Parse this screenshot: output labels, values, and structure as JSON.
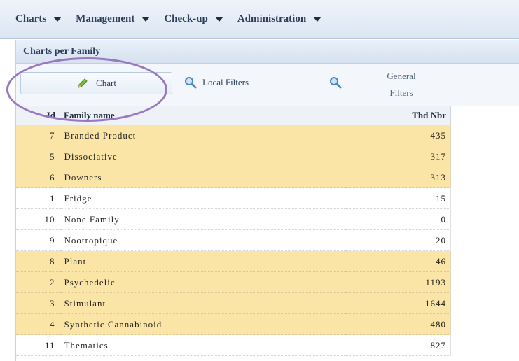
{
  "menu": {
    "items": [
      {
        "label": "Charts"
      },
      {
        "label": "Management"
      },
      {
        "label": "Check-up"
      },
      {
        "label": "Administration"
      }
    ]
  },
  "panel": {
    "title": "Charts per Family"
  },
  "toolbar": {
    "chart_label": "Chart",
    "local_filters_label": "Local Filters",
    "general_filters_line1": "General",
    "general_filters_line2": "Filters"
  },
  "table": {
    "columns": {
      "id": "Id",
      "name": "Family name",
      "nbr": "Thd Nbr"
    },
    "rows": [
      {
        "id": "7",
        "name": "Branded Product",
        "nbr": "435",
        "highlight": true
      },
      {
        "id": "5",
        "name": "Dissociative",
        "nbr": "317",
        "highlight": true
      },
      {
        "id": "6",
        "name": "Downers",
        "nbr": "313",
        "highlight": true
      },
      {
        "id": "1",
        "name": "Fridge",
        "nbr": "15",
        "highlight": false
      },
      {
        "id": "10",
        "name": "None Family",
        "nbr": "0",
        "highlight": false
      },
      {
        "id": "9",
        "name": "Nootropique",
        "nbr": "20",
        "highlight": false
      },
      {
        "id": "8",
        "name": "Plant",
        "nbr": "46",
        "highlight": true
      },
      {
        "id": "2",
        "name": "Psychedelic",
        "nbr": "1193",
        "highlight": true
      },
      {
        "id": "3",
        "name": "Stimulant",
        "nbr": "1644",
        "highlight": true
      },
      {
        "id": "4",
        "name": "Synthetic Cannabinoid",
        "nbr": "480",
        "highlight": true
      },
      {
        "id": "11",
        "name": "Thematics",
        "nbr": "827",
        "highlight": false
      }
    ]
  },
  "colors": {
    "highlight_row": "#fbe5a6",
    "annotation_ellipse": "#9a78c1"
  },
  "icons": {
    "chart": "pencil-icon",
    "local_filters": "search-icon",
    "general_filters": "search-icon",
    "menu_caret": "caret-down-icon"
  }
}
